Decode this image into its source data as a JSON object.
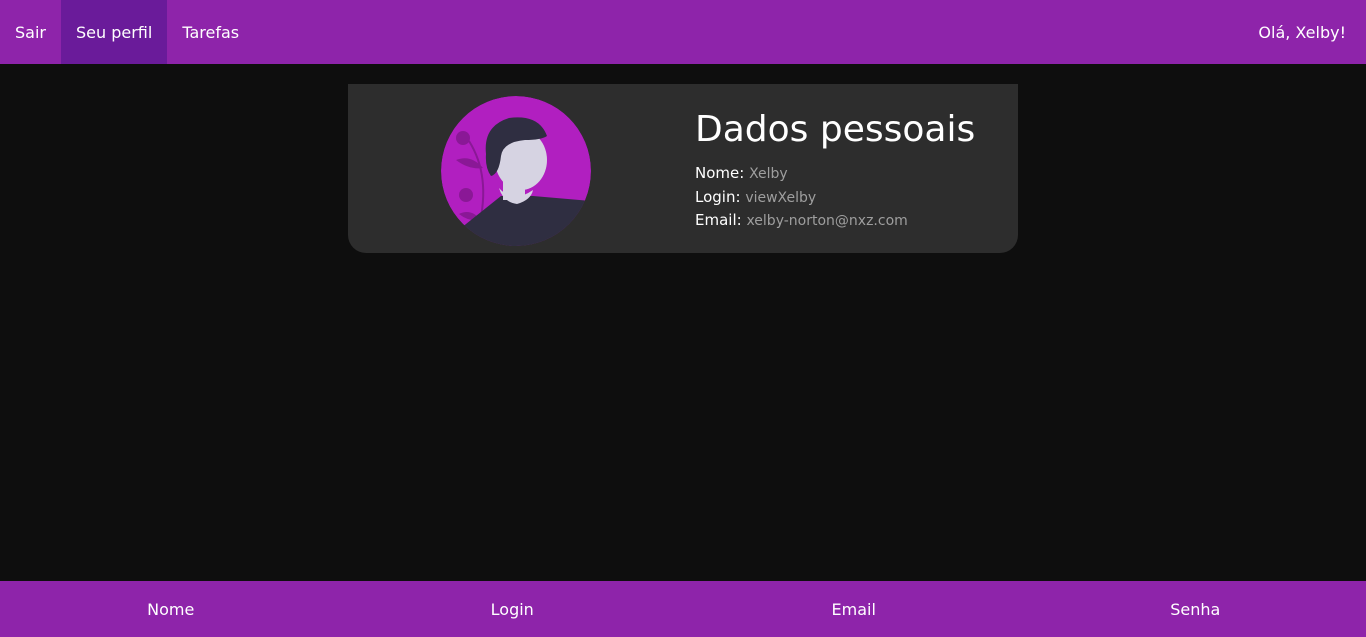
{
  "header": {
    "nav": [
      {
        "label": "Sair"
      },
      {
        "label": "Seu perfil"
      },
      {
        "label": "Tarefas"
      }
    ],
    "greeting": "Olá, Xelby!"
  },
  "profile": {
    "title": "Dados pessoais",
    "fields": [
      {
        "label": "Nome:",
        "value": "Xelby"
      },
      {
        "label": "Login:",
        "value": "viewXelby"
      },
      {
        "label": "Email:",
        "value": "xelby-norton@nxz.com"
      }
    ]
  },
  "footer": {
    "items": [
      {
        "label": "Nome"
      },
      {
        "label": "Login"
      },
      {
        "label": "Email"
      },
      {
        "label": "Senha"
      }
    ]
  },
  "colors": {
    "accent": "#8e24aa",
    "accent_active": "#6a1b9a",
    "background": "#0e0e0e",
    "card": "#2d2d2d"
  }
}
